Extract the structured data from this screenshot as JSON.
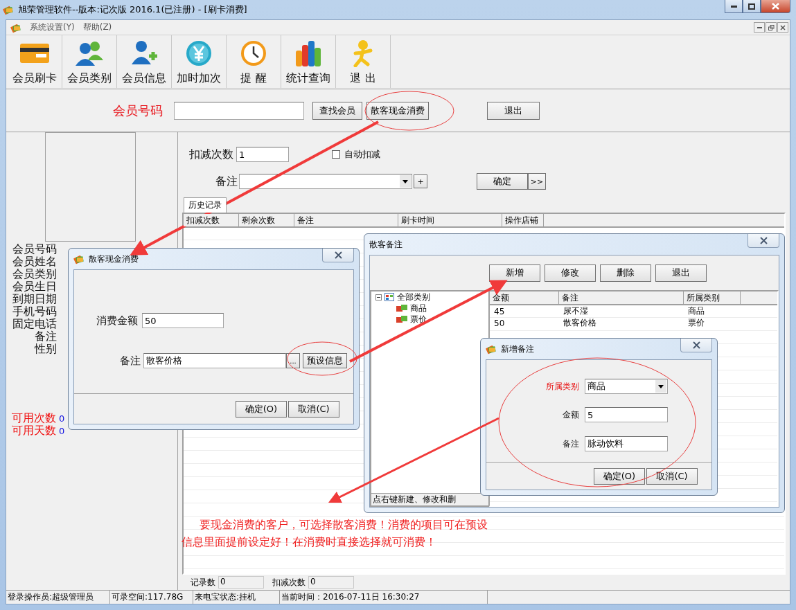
{
  "window": {
    "title": "旭荣管理软件--版本:记次版 2016.1(已注册) - [刷卡消费]"
  },
  "menu": [
    {
      "label": "系统设置(Y)"
    },
    {
      "label": "帮助(Z)"
    }
  ],
  "toolbar": [
    {
      "label": "会员刷卡",
      "kind": "card"
    },
    {
      "label": "会员类别",
      "kind": "members"
    },
    {
      "label": "会员信息",
      "kind": "member-add"
    },
    {
      "label": "加时加次",
      "kind": "coin"
    },
    {
      "label": "提 醒",
      "kind": "clock"
    },
    {
      "label": "统计查询",
      "kind": "chart"
    },
    {
      "label": "退 出",
      "kind": "exit"
    }
  ],
  "search": {
    "label": "会员号码",
    "buttons": [
      "查找会员",
      "散客现金消费"
    ],
    "exit": "退出"
  },
  "member": {
    "fields": [
      "会员号码",
      "会员姓名",
      "会员类别",
      "会员生日",
      "到期日期",
      "手机号码",
      "固定电话",
      "备注",
      "性别"
    ],
    "counts": [
      {
        "label": "可用次数",
        "value": "0"
      },
      {
        "label": "可用天数",
        "value": "0"
      }
    ]
  },
  "deduct": {
    "label": "扣减次数",
    "value": "1",
    "auto": {
      "label": "自动扣减",
      "checked": false
    },
    "note_label": "备注",
    "plus": "+",
    "confirm": "确定",
    "more": ">>"
  },
  "tabs": [
    {
      "label": "历史记录",
      "selected": true
    }
  ],
  "history": {
    "columns": [
      "扣减次数",
      "剩余次数",
      "备注",
      "刷卡时间",
      "操作店铺"
    ]
  },
  "footer": [
    {
      "label": "记录数",
      "value": "0"
    },
    {
      "label": "扣减次数",
      "value": "0"
    }
  ],
  "status_bar": [
    "登录操作员:超级管理员",
    "可录空间:117.78G",
    "来电宝状态:挂机",
    "当前时间：2016-07-11日 16:30:27"
  ],
  "cash_dialog": {
    "title": "散客现金消费",
    "amount_label": "消费金额",
    "amount": "50",
    "note_label": "备注",
    "note": "散客价格",
    "browse": "...",
    "preset": "预设信息",
    "ok": "确定(O)",
    "cancel": "取消(C)"
  },
  "note_dialog": {
    "title": "散客备注",
    "buttons": [
      "新增",
      "修改",
      "删除",
      "退出"
    ],
    "tree": {
      "label": "全部类别",
      "expanded": true,
      "children": [
        {
          "label": "商品"
        },
        {
          "label": "票价"
        }
      ]
    },
    "columns": [
      "金额",
      "备注",
      "所属类别"
    ],
    "rows": [
      [
        "45",
        "尿不湿",
        "商品"
      ],
      [
        "50",
        "散客价格",
        "票价"
      ]
    ],
    "hint": "点右键新建、修改和删"
  },
  "add_dialog": {
    "title": "新增备注",
    "category_label": "所属类别",
    "category": "商品",
    "amount_label": "金额",
    "amount": "5",
    "note_label": "备注",
    "note": "脉动饮料",
    "ok": "确定(O)",
    "cancel": "取消(C)"
  },
  "annotation": {
    "lines": [
      "要现金消费的客户，可选择散客消费！消费的项目可在预设",
      "信息里面提前设定好！在消费时直接选择就可消费！"
    ]
  }
}
